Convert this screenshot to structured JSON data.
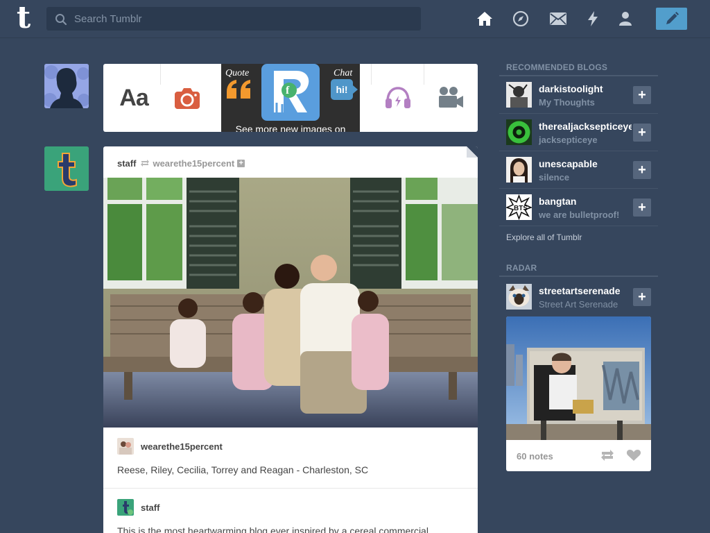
{
  "header": {
    "logo": "t",
    "search_placeholder": "Search Tumblr",
    "nav_icons": [
      "home-icon",
      "explore-icon",
      "inbox-icon",
      "activity-icon",
      "account-icon"
    ],
    "compose_icon": "pencil-icon"
  },
  "post_types": [
    {
      "name": "text",
      "label": "Aa"
    },
    {
      "name": "photo",
      "icon": "camera-icon"
    },
    {
      "name": "quote",
      "label": "Quote"
    },
    {
      "name": "link",
      "icon": "link-icon"
    },
    {
      "name": "chat",
      "label": "Chat",
      "bubble": "hi!"
    },
    {
      "name": "audio",
      "icon": "headphones-icon"
    },
    {
      "name": "video",
      "icon": "video-camera-icon"
    }
  ],
  "promo": {
    "quote_label": "Quote",
    "chat_label": "Chat",
    "chat_bubble": "hi!",
    "caption": "See more new images on"
  },
  "post": {
    "author": "staff",
    "reblogged_from": "wearethe15percent",
    "trail": [
      {
        "author": "wearethe15percent",
        "text": "Reese, Riley, Cecilia, Torrey and Reagan - Charleston, SC"
      },
      {
        "author": "staff",
        "text": "This is the most heartwarming blog ever inspired by a cereal commercial."
      }
    ]
  },
  "sidebar": {
    "recommended_heading": "RECOMMENDED BLOGS",
    "recommended": [
      {
        "name": "darkistoolight",
        "title": "My Thoughts"
      },
      {
        "name": "therealjacksepticeye",
        "title": "jacksepticeye"
      },
      {
        "name": "unescapable",
        "title": "silence"
      },
      {
        "name": "bangtan",
        "title": "we are bulletproof!"
      }
    ],
    "explore_link": "Explore all of Tumblr",
    "radar_heading": "RADAR",
    "radar": {
      "name": "streetartserenade",
      "title": "Street Art Serenade",
      "notes": "60 notes"
    }
  },
  "colors": {
    "background": "#36465d",
    "accent": "#529ecc",
    "muted": "#8191a5"
  }
}
